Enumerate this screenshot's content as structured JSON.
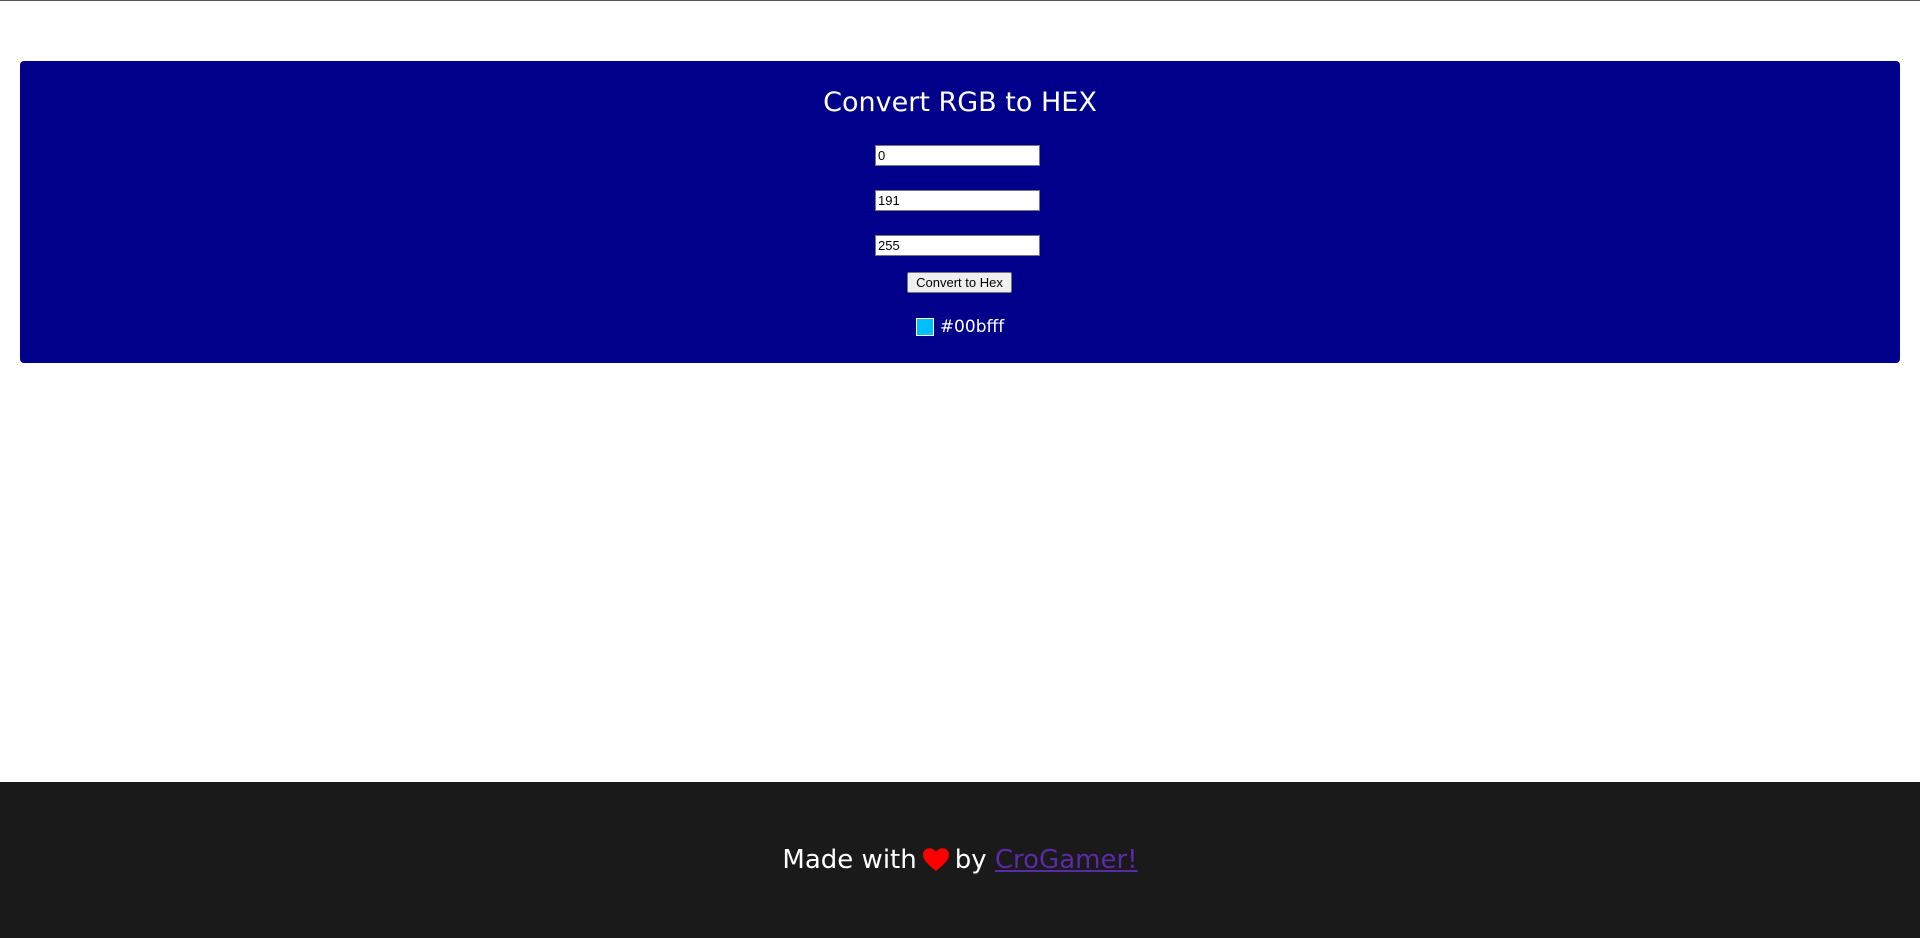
{
  "converter": {
    "title": "Convert RGB to HEX",
    "red_value": "0",
    "green_value": "191",
    "blue_value": "255",
    "button_label": "Convert to Hex",
    "result_hex": "#00bfff",
    "result_swatch_color": "#00bfff",
    "panel_color": "#00008b"
  },
  "footer": {
    "prefix": "Made with",
    "heart_icon": "heart-icon",
    "middle": "by",
    "link_text": "CroGamer!",
    "link_color": "#5a2aa8",
    "heart_color": "#ff0000",
    "background": "#1a1a1a"
  }
}
